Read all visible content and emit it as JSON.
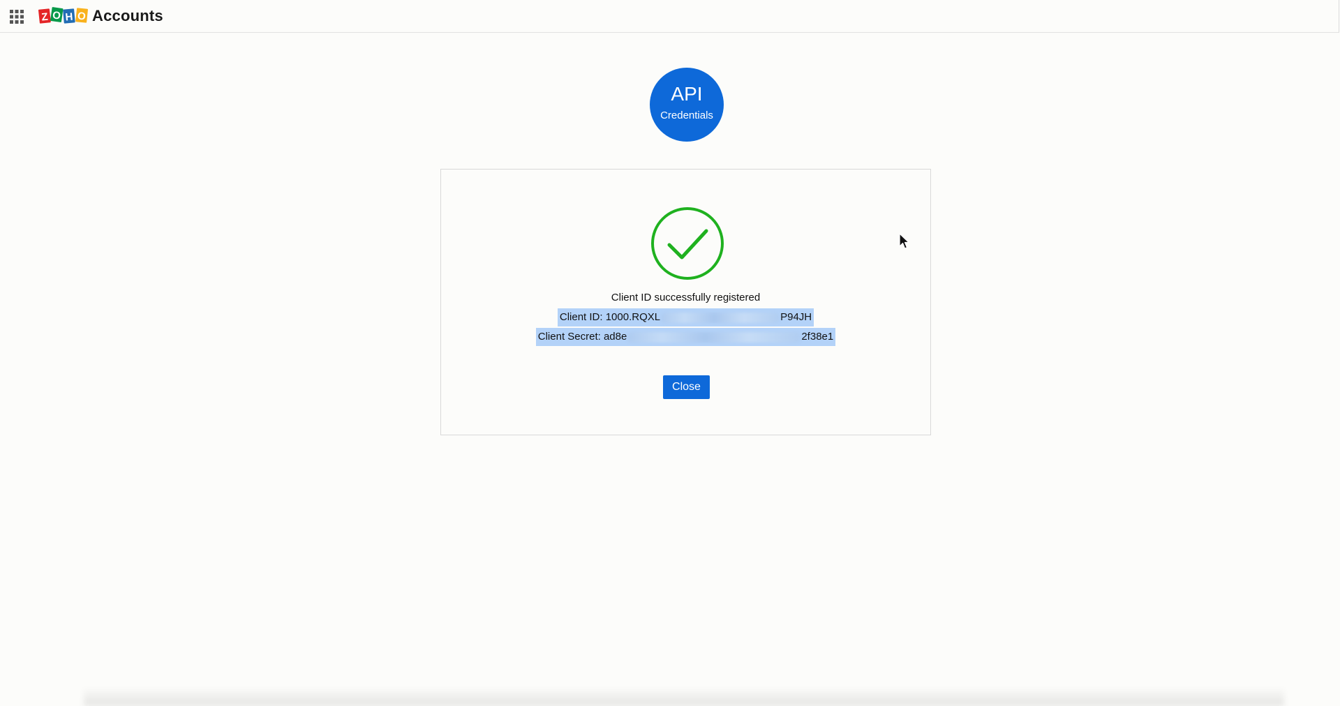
{
  "header": {
    "app_grid_icon": "app-grid-icon",
    "logo_letters": [
      "Z",
      "O",
      "H",
      "O"
    ],
    "logo_colors": [
      "#e42527",
      "#089949",
      "#226db4",
      "#f9b21d"
    ],
    "brand": "Accounts"
  },
  "badge": {
    "title": "API",
    "subtitle": "Credentials",
    "color": "#0e69d9"
  },
  "panel": {
    "status_icon": "check-circle-icon",
    "status_color": "#1fb11f",
    "message": "Client ID successfully registered",
    "client_id_label": "Client ID: 1000.RQXL",
    "client_id_end": "P94JH",
    "client_secret_label": "Client Secret: ad8e",
    "client_secret_end": "2f38e1",
    "close_label": "Close"
  }
}
